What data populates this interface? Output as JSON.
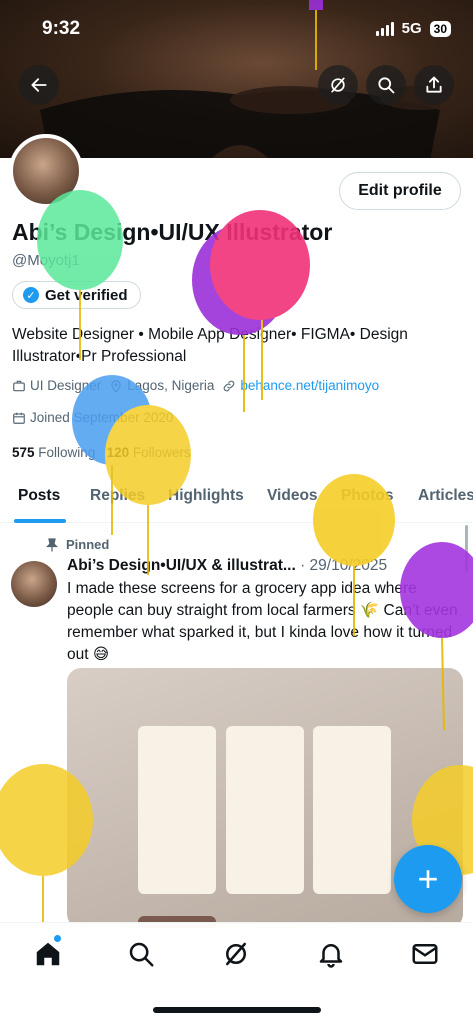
{
  "status": {
    "time": "9:32",
    "network": "5G",
    "battery": "30"
  },
  "header": {
    "back_icon": "arrow-left-icon",
    "grok_icon": "slash-circle-icon",
    "search_icon": "search-icon",
    "share_icon": "share-icon"
  },
  "profile": {
    "edit_label": "Edit profile",
    "name": "Abi’s Design•UI/UX Illustrator",
    "handle": "@Moyotj1",
    "verified_label": "Get verified",
    "bio": "Website Designer • Mobile App Designer• FIGMA• Design Illustrator•Pr Professional",
    "category": "UI Designer",
    "location": "Lagos, Nigeria",
    "link": "behance.net/tijanimoyo",
    "joined": "Joined September 2020",
    "following_count": "575",
    "following_label": "Following",
    "followers_count": "120",
    "followers_label": "Followers"
  },
  "tabs": [
    "Posts",
    "Replies",
    "Highlights",
    "Videos",
    "Photos",
    "Articles"
  ],
  "post": {
    "pinned_label": "Pinned",
    "author": "Abi’s Design•UI/UX & illustrat...",
    "date": "· 29/10/2025",
    "text": "I made these screens for a grocery app idea where people can buy straight from local farmers 🌾 Can’t even remember what sparked it, but I kinda love how it turned out 😅",
    "more_label": "···"
  },
  "fab_label": "+",
  "bottom_nav": [
    "home-icon",
    "search-icon",
    "grok-icon",
    "notifications-icon",
    "messages-icon"
  ],
  "colors": {
    "accent": "#1d9bf0",
    "text": "#0f1419",
    "muted": "#536471"
  }
}
